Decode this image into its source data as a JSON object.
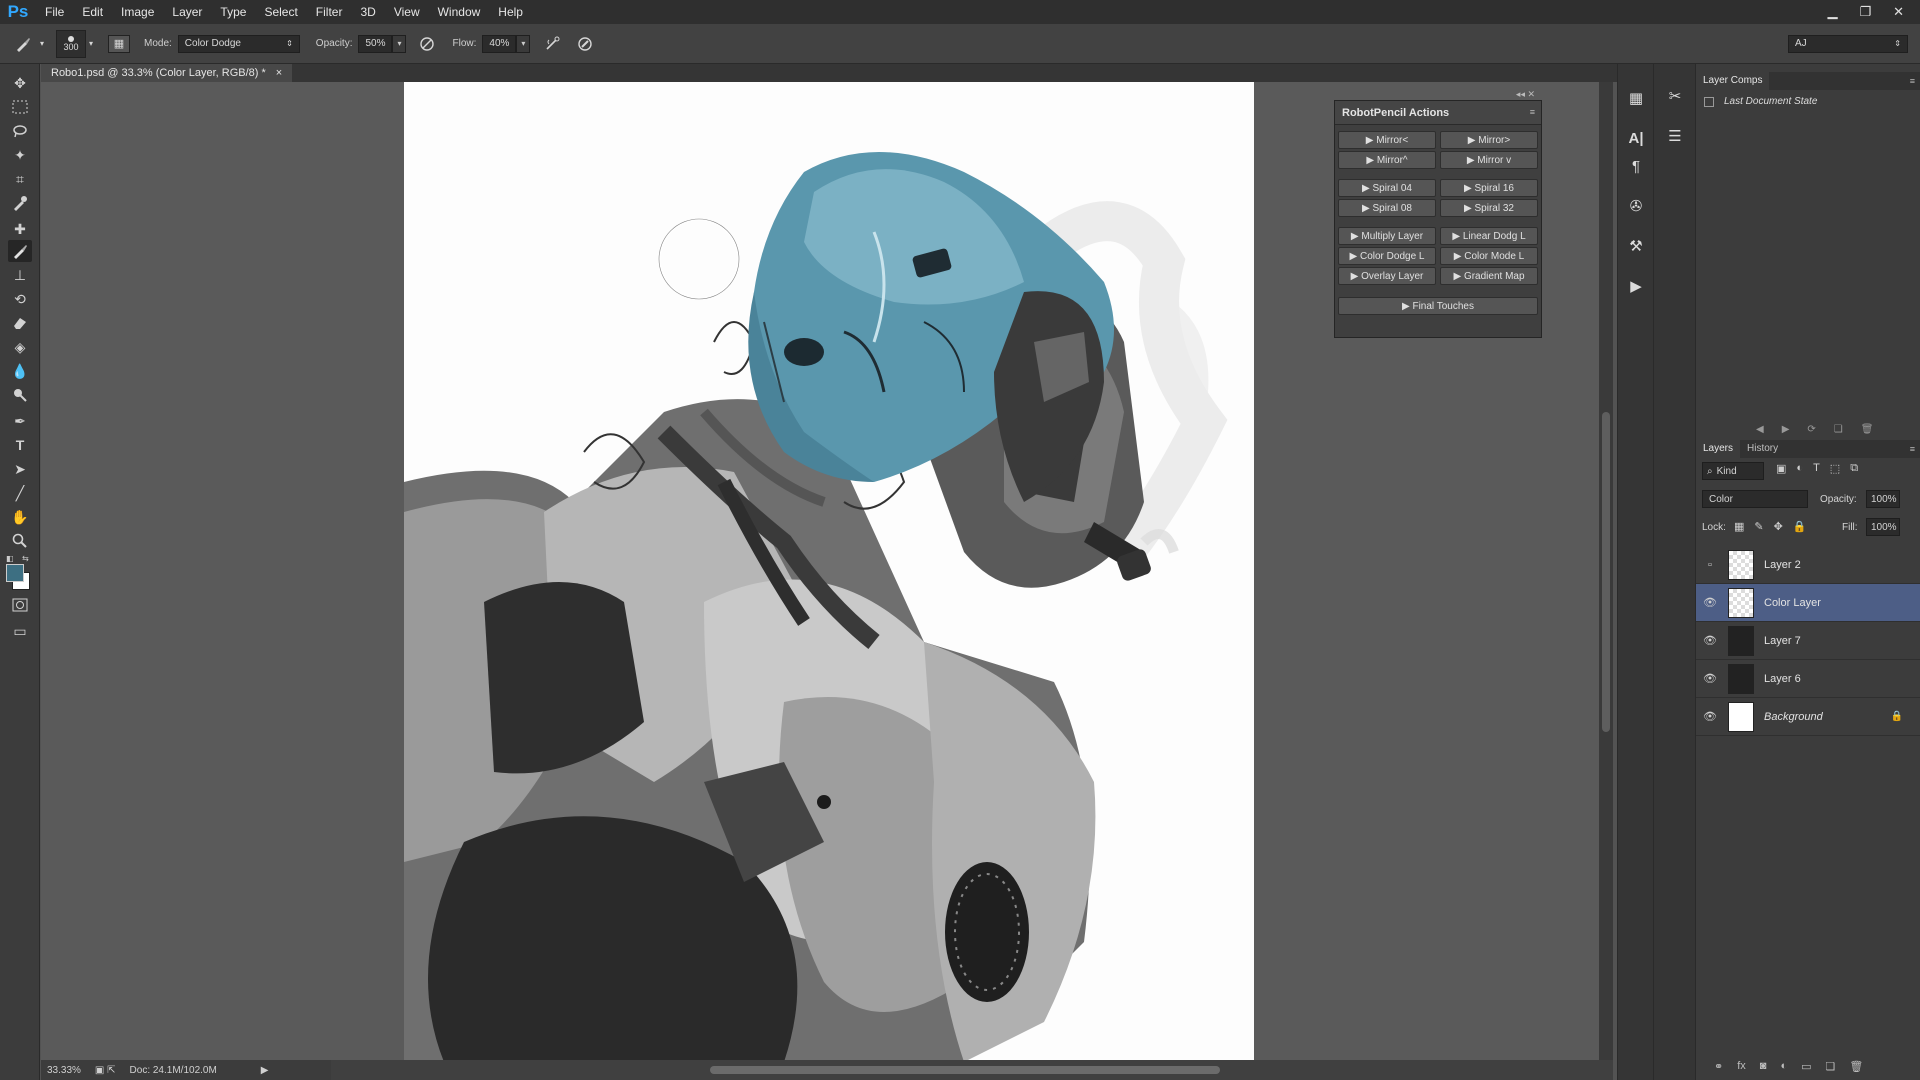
{
  "menubar": {
    "logo": "Ps",
    "items": [
      "File",
      "Edit",
      "Image",
      "Layer",
      "Type",
      "Select",
      "Filter",
      "3D",
      "View",
      "Window",
      "Help"
    ]
  },
  "options": {
    "brush_size": "300",
    "mode_label": "Mode:",
    "mode_value": "Color Dodge",
    "opacity_label": "Opacity:",
    "opacity_value": "50%",
    "flow_label": "Flow:",
    "flow_value": "40%",
    "workspace": "AJ"
  },
  "document": {
    "tab_title": "Robo1.psd @ 33.3% (Color Layer, RGB/8) *",
    "close_glyph": "×"
  },
  "status": {
    "zoom": "33.33%",
    "doc_info": "Doc: 24.1M/102.0M"
  },
  "actions_panel": {
    "title": "RobotPencil Actions",
    "buttons": [
      "Mirror<",
      "Mirror>",
      "Mirror^",
      "Mirror v",
      "Spiral 04",
      "Spiral 16",
      "Spiral 08",
      "Spiral 32",
      "Multiply Layer",
      "Linear Dodg L",
      "Color Dodge L",
      "Color Mode L",
      "Overlay Layer",
      "Gradient Map",
      "Final Touches"
    ]
  },
  "layer_comps": {
    "tab": "Layer Comps",
    "items": [
      "Last Document State"
    ]
  },
  "layers_panel": {
    "tabs": [
      "Layers",
      "History"
    ],
    "filter_kind": "Kind",
    "blend_mode": "Color",
    "opacity_label": "Opacity:",
    "opacity_value": "100%",
    "lock_label": "Lock:",
    "fill_label": "Fill:",
    "fill_value": "100%",
    "layers": [
      {
        "name": "Layer 2",
        "visible": false,
        "selected": false
      },
      {
        "name": "Color Layer",
        "visible": true,
        "selected": true
      },
      {
        "name": "Layer 7",
        "visible": true,
        "selected": false
      },
      {
        "name": "Layer 6",
        "visible": true,
        "selected": false
      },
      {
        "name": "Background",
        "visible": true,
        "selected": false,
        "locked": true
      }
    ]
  },
  "colors": {
    "foreground": "#3d6f82",
    "background": "#ffffff",
    "selection": "#4d5e86",
    "helmet_tint": "#5a97ad"
  }
}
